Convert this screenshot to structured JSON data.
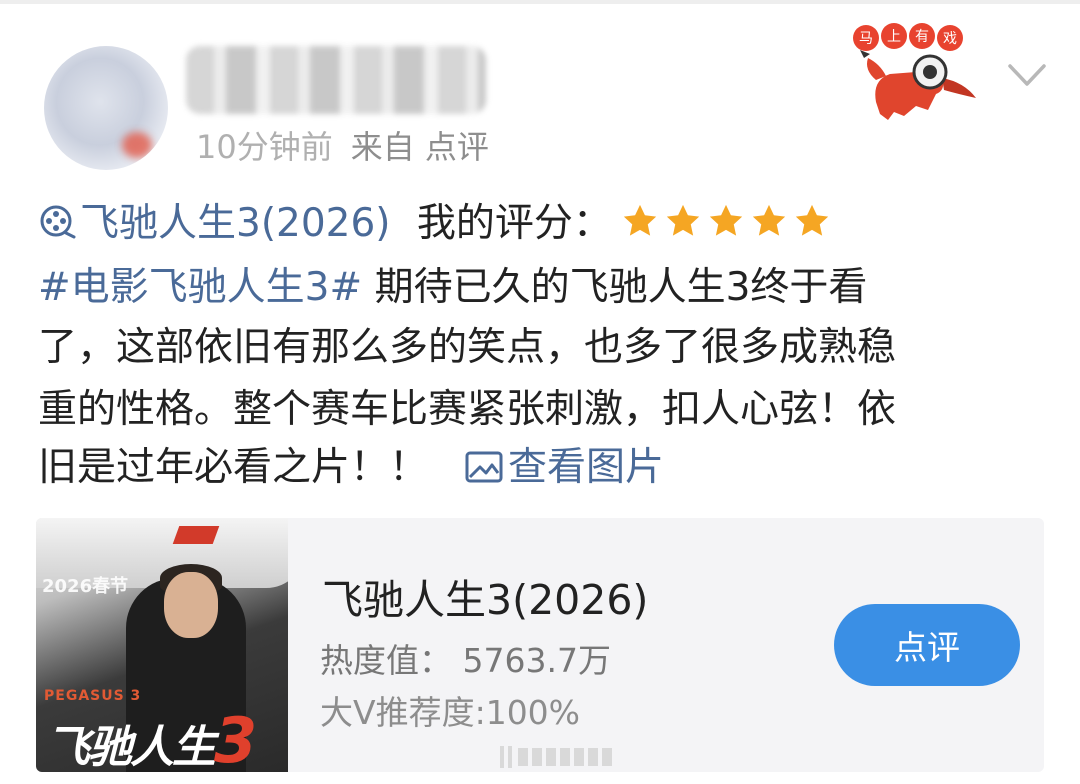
{
  "header": {
    "time": "10分钟前",
    "source": "来自 点评",
    "badge_text": "马上有戏"
  },
  "post": {
    "movie_name": "飞驰人生3(2026)",
    "rating_label": "我的评分：",
    "rating_stars": 5,
    "rating_max": 5,
    "star_color": "#f5a623",
    "hashtag": "#电影飞驰人生3#",
    "line1_text": "期待已久的飞驰人生3终于看",
    "line2": "了，这部依旧有那么多的笑点，也多了很多成熟稳",
    "line3": "重的性格。整个赛车比赛紧张刺激，扣人心弦！依",
    "line4_text": "旧是过年必看之片！！",
    "view_images": "查看图片",
    "link_color": "#4a6a98"
  },
  "card": {
    "poster_year": "2026春节",
    "poster_en": "PEGASUS 3",
    "poster_cn": "飞驰人生",
    "poster_num": "3",
    "title": "飞驰人生3(2026)",
    "heat": "热度值：  5763.7万",
    "recommend": "大V推荐度:100%",
    "review_button": "点评",
    "button_color": "#3a8fe5"
  }
}
